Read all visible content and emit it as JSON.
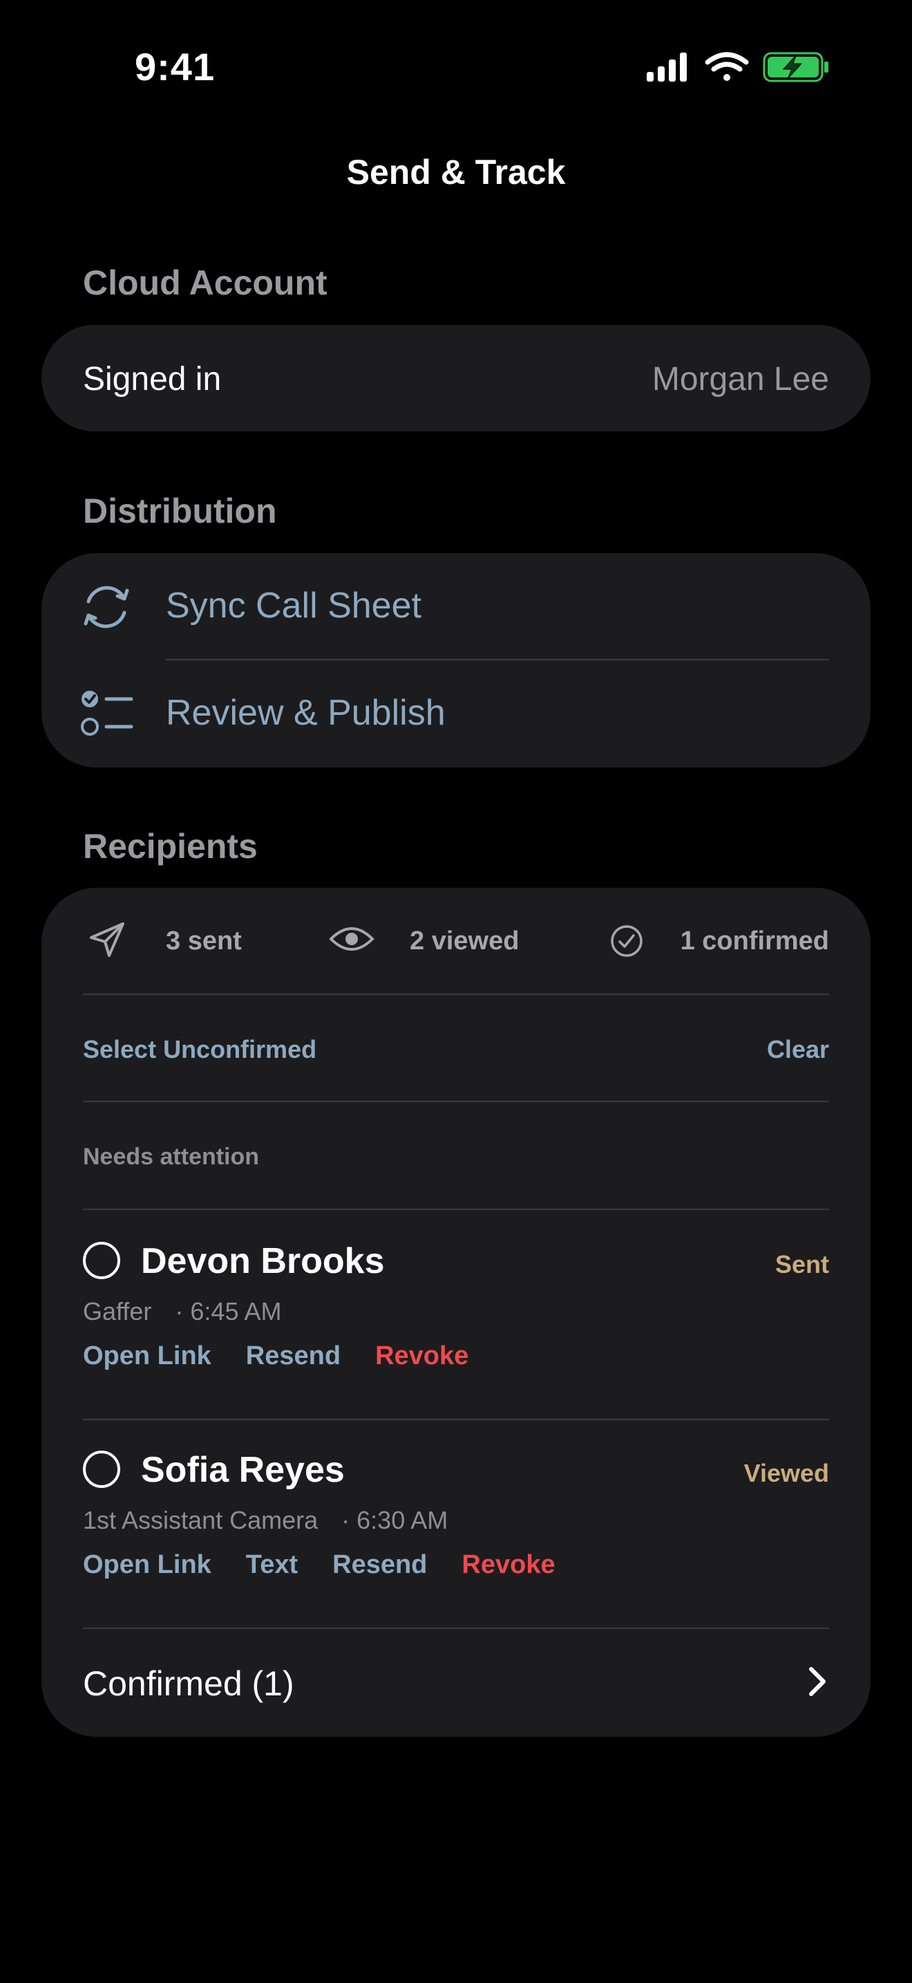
{
  "status_bar": {
    "time": "9:41"
  },
  "nav": {
    "title": "Send & Track"
  },
  "cloud": {
    "header": "Cloud Account",
    "row_label": "Signed in",
    "row_value": "Morgan Lee"
  },
  "distribution": {
    "header": "Distribution",
    "items": [
      {
        "label": "Sync Call Sheet",
        "icon": "sync-icon"
      },
      {
        "label": "Review & Publish",
        "icon": "checklist-icon"
      }
    ]
  },
  "recipients": {
    "header": "Recipients",
    "stats": {
      "sent": "3 sent",
      "viewed": "2 viewed",
      "confirmed": "1 confirmed"
    },
    "select_unconfirmed": "Select Unconfirmed",
    "clear": "Clear",
    "needs_attention": "Needs attention",
    "people": [
      {
        "name": "Devon Brooks",
        "status": "Sent",
        "role": "Gaffer",
        "time": "· 6:45 AM",
        "actions": [
          "Open Link",
          "Resend",
          "Revoke"
        ]
      },
      {
        "name": "Sofia Reyes",
        "status": "Viewed",
        "role": "1st Assistant Camera",
        "time": "· 6:30 AM",
        "actions": [
          "Open Link",
          "Text",
          "Resend",
          "Revoke"
        ]
      }
    ],
    "confirmed_row": "Confirmed (1)"
  },
  "colors": {
    "background": "#000000",
    "card": "#1c1c1e",
    "accent_blue": "#8ea9c1",
    "danger": "#ef4a4f",
    "status_gold": "#c9ad7d",
    "battery_green": "#34c759"
  }
}
